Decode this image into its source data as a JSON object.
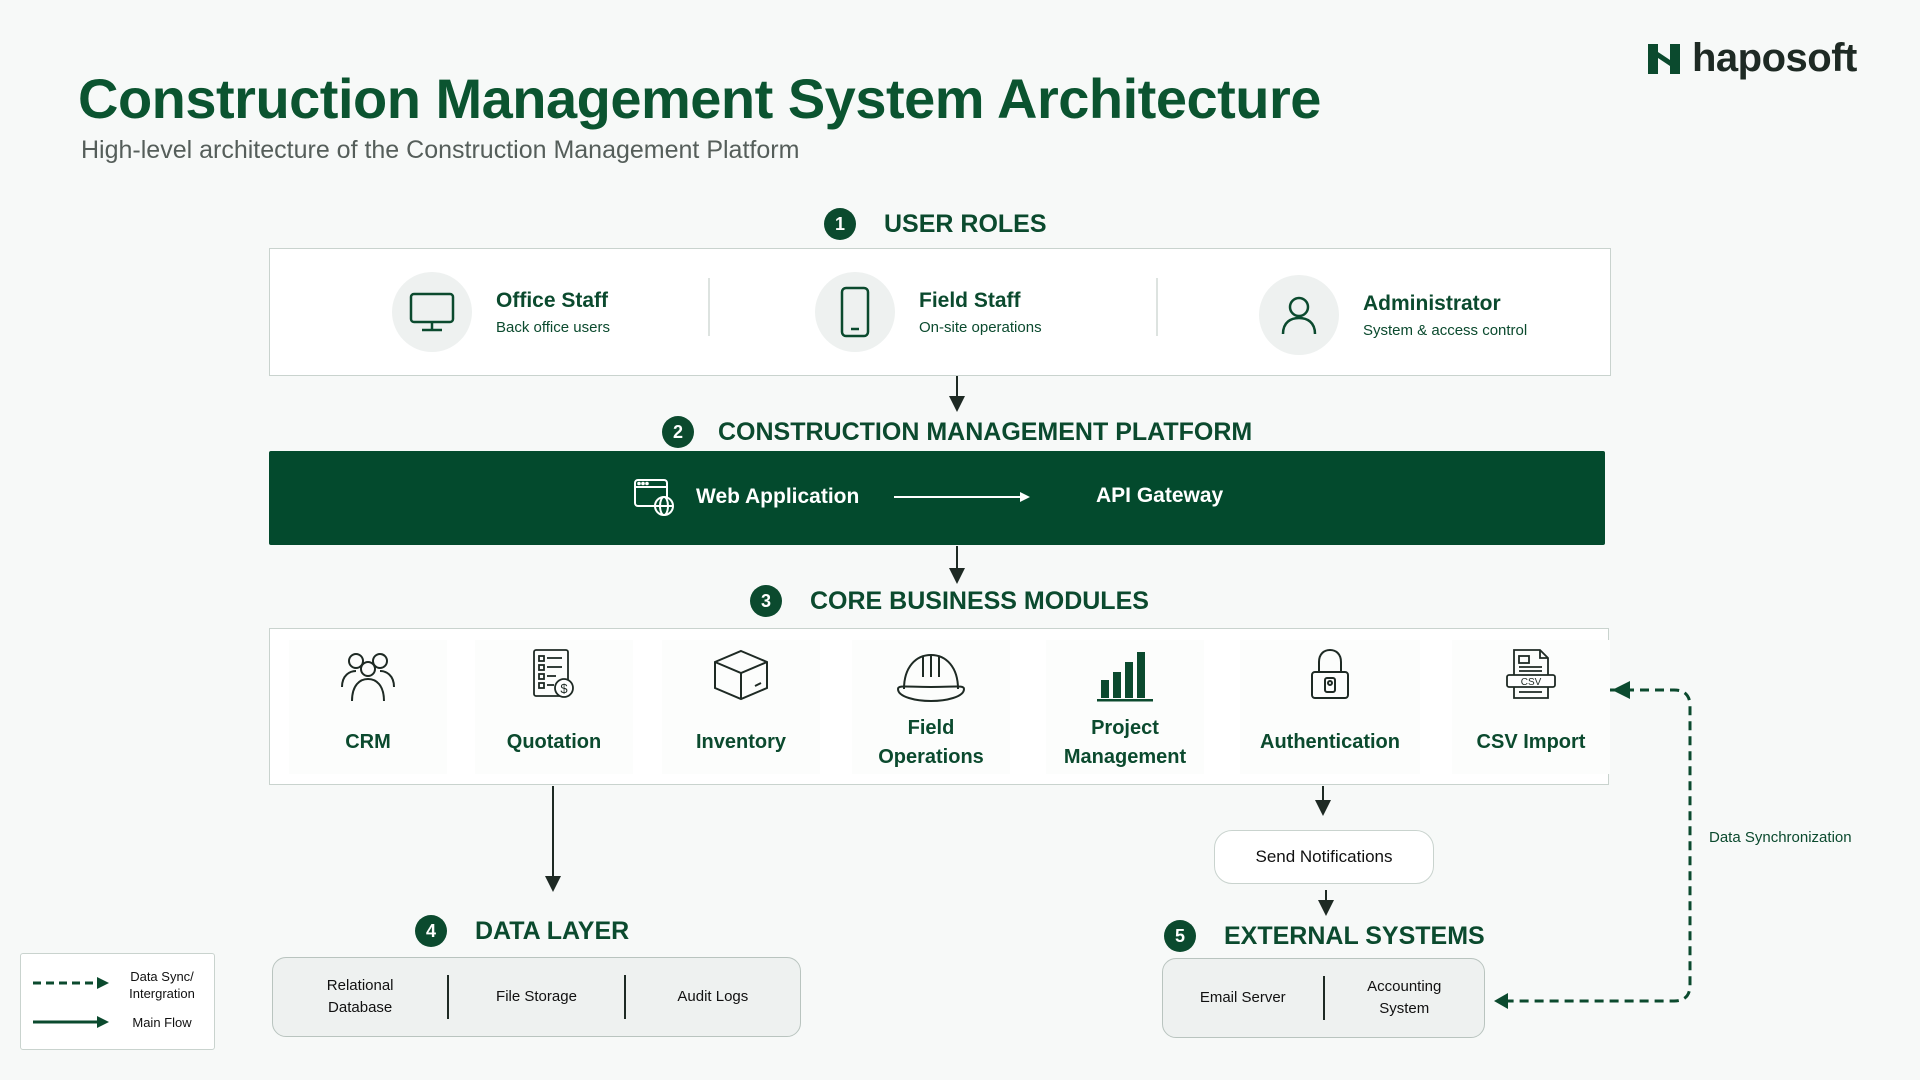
{
  "title": "Construction Management System Architecture",
  "subtitle": "High-level architecture of the Construction Management Platform",
  "logo": {
    "text": "haposoft",
    "color": "#0b4a2e"
  },
  "colors": {
    "primary": "#0b4a2e",
    "platform_bg": "#034a2d",
    "background": "#f7f9f8"
  },
  "sections": {
    "user_roles": {
      "number": "1",
      "title": "USER ROLES"
    },
    "platform": {
      "number": "2",
      "title": "CONSTRUCTION MANAGEMENT PLATFORM"
    },
    "modules": {
      "number": "3",
      "title": "CORE BUSINESS MODULES"
    },
    "data_layer": {
      "number": "4",
      "title": "DATA LAYER"
    },
    "external": {
      "number": "5",
      "title": "EXTERNAL SYSTEMS"
    }
  },
  "roles": [
    {
      "name": "Office Staff",
      "desc": "Back office users",
      "icon": "monitor-icon"
    },
    {
      "name": "Field Staff",
      "desc": "On-site operations",
      "icon": "smartphone-icon"
    },
    {
      "name": "Administrator",
      "desc": "System & access control",
      "icon": "user-icon"
    }
  ],
  "platform": {
    "web_app": "Web Application",
    "api_gateway": "API Gateway"
  },
  "modules": [
    {
      "label": "CRM",
      "icon": "people-icon"
    },
    {
      "label": "Quotation",
      "icon": "quotation-icon"
    },
    {
      "label": "Inventory",
      "icon": "box-icon"
    },
    {
      "label_line1": "Field",
      "label_line2": "Operations",
      "icon": "hardhat-icon"
    },
    {
      "label_line1": "Project",
      "label_line2": "Management",
      "icon": "bar-chart-icon"
    },
    {
      "label": "Authentication",
      "icon": "lock-icon"
    },
    {
      "label": "CSV Import",
      "icon": "csv-file-icon",
      "icon_text": "CSV"
    }
  ],
  "notifications": "Send Notifications",
  "data_layer": [
    {
      "line1": "Relational",
      "line2": "Database"
    },
    {
      "line1": "File Storage"
    },
    {
      "line1": "Audit Logs"
    }
  ],
  "external_systems": [
    {
      "line1": "Email Server"
    },
    {
      "line1": "Accounting",
      "line2": "System"
    }
  ],
  "data_sync_label": "Data Synchronization",
  "legend": {
    "dashed_line1": "Data Sync/",
    "dashed_line2": "Intergration",
    "solid": "Main Flow"
  }
}
